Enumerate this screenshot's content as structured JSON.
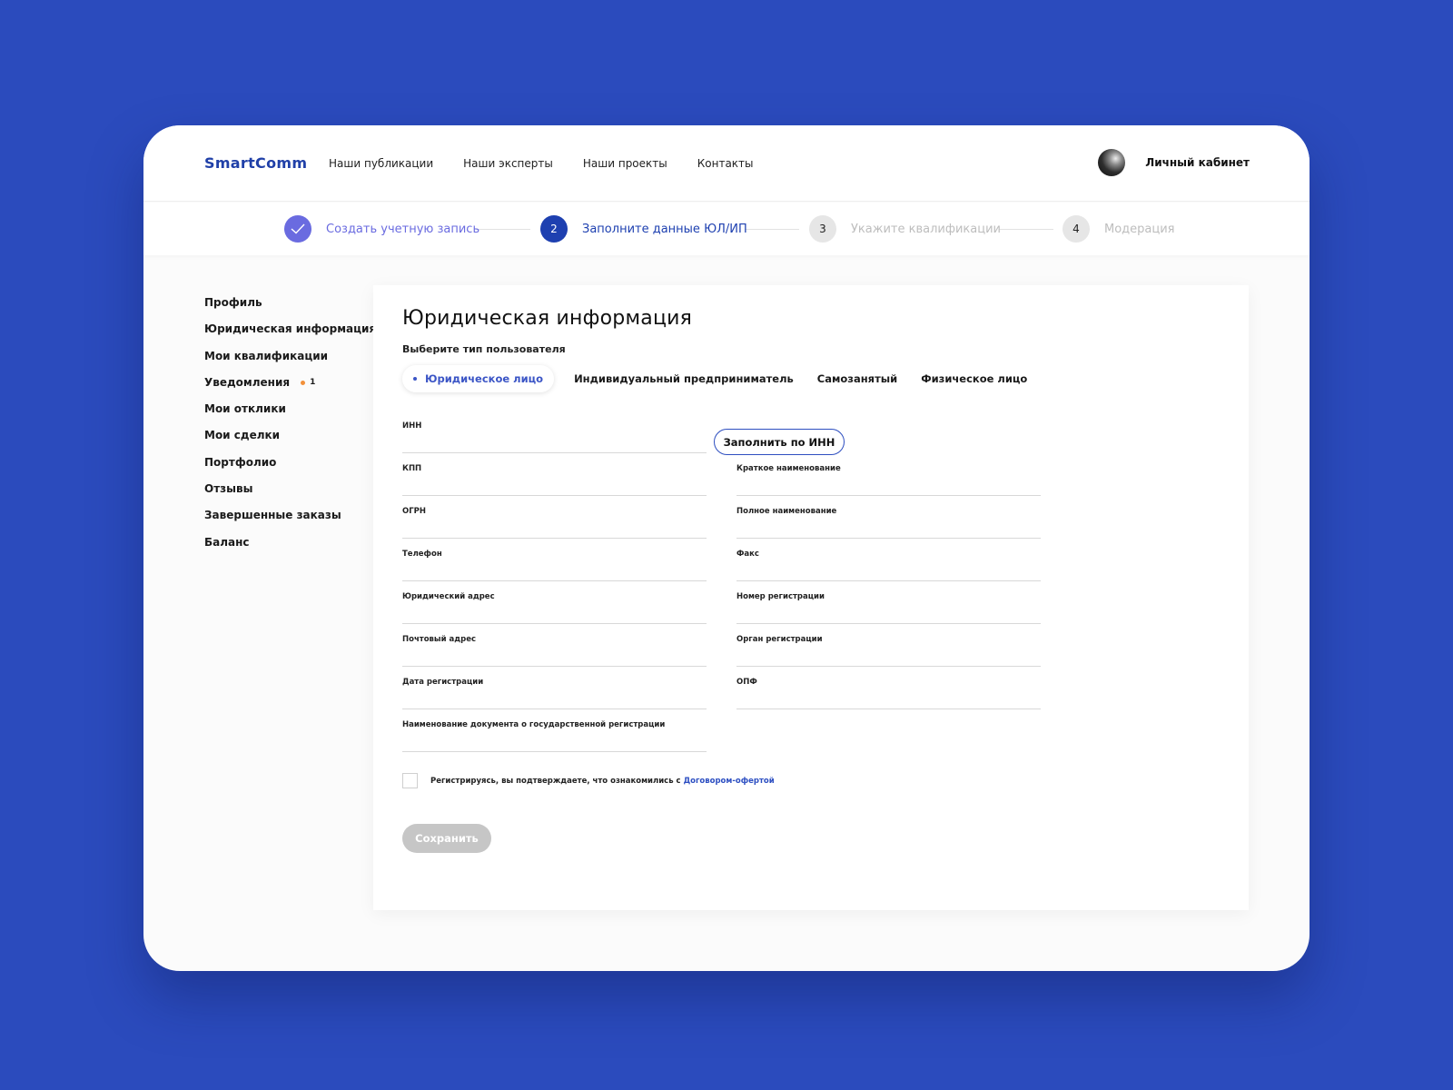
{
  "header": {
    "logo": "SmartComm",
    "nav": [
      "Наши публикации",
      "Наши эксперты",
      "Наши проекты",
      "Контакты"
    ],
    "account_label": "Личный кабинет"
  },
  "stepper": {
    "steps": [
      {
        "number": "",
        "label": "Создать учетную запись",
        "state": "done"
      },
      {
        "number": "2",
        "label": "Заполните данные ЮЛ/ИП",
        "state": "active"
      },
      {
        "number": "3",
        "label": "Укажите квалификации",
        "state": "todo"
      },
      {
        "number": "4",
        "label": "Модерация",
        "state": "todo"
      }
    ]
  },
  "sidebar": {
    "items": [
      {
        "label": "Профиль"
      },
      {
        "label": "Юридическая информация"
      },
      {
        "label": "Мои квалификации"
      },
      {
        "label": "Уведомления",
        "badge": "1"
      },
      {
        "label": "Мои отклики"
      },
      {
        "label": "Мои сделки"
      },
      {
        "label": "Портфолио"
      },
      {
        "label": "Отзывы"
      },
      {
        "label": "Завершенные заказы"
      },
      {
        "label": "Баланс"
      }
    ]
  },
  "form": {
    "title": "Юридическая информация",
    "type_label": "Выберите тип пользователя",
    "types": [
      "Юридическое лицо",
      "Индивидуальный предприниматель",
      "Самозанятый",
      "Физическое лицо"
    ],
    "selected_type": "Юридическое лицо",
    "inn_label": "ИНН",
    "inn_button": "Заполнить по ИНН",
    "left_fields": [
      "КПП",
      "ОГРН",
      "Телефон",
      "Юридический адрес",
      "Почтовый адрес",
      "Дата регистрации",
      "Наименование документа о государственной регистрации"
    ],
    "right_fields": [
      "Краткое наименование",
      "Полное наименование",
      "Факс",
      "Номер регистрации",
      "Орган регистрации",
      "ОПФ"
    ],
    "agree_text": "Регистрируясь, вы подтверждаете, что ознакомились с ",
    "agree_link": "Договором-офертой",
    "save_button": "Сохранить"
  },
  "colors": {
    "background": "#2b4bbd",
    "accent": "#1e40b0",
    "done_step": "#6a6be0",
    "badge": "#f2903a",
    "disabled_button": "#c6c6c6"
  }
}
